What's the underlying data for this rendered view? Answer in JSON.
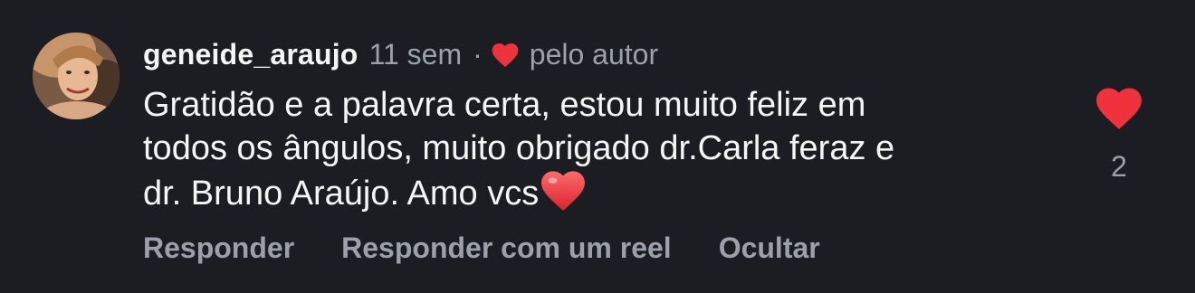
{
  "comment": {
    "username": "geneide_araujo",
    "time": "11 sem",
    "separator": "·",
    "liked_by_author_label": "pelo autor",
    "text_lines": [
      "Gratidão e a palavra certa, estou muito feliz em",
      "todos os ângulos, muito obrigado dr.Carla feraz e",
      "dr. Bruno Araújo. Amo vcs"
    ],
    "text_emoji": "heart-emoji",
    "like_count": "2"
  },
  "actions": {
    "reply": "Responder",
    "reply_reel": "Responder com um reel",
    "hide": "Ocultar"
  },
  "icons": {
    "author_like": "heart-icon",
    "like": "heart-icon"
  },
  "colors": {
    "background": "#1c1d22",
    "heart": "#f0323c",
    "text": "#f5f5f5",
    "muted": "#9ba0ab"
  }
}
